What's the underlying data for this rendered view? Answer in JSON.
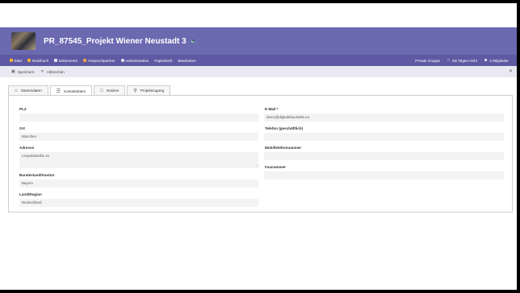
{
  "site": {
    "title": "PR_87545_Projekt Wiener Neustadt 3",
    "speaker_icon": "speaker-icon"
  },
  "nav": {
    "items": [
      {
        "label": "Start",
        "icon": "home-icon",
        "color": "#f0b429"
      },
      {
        "label": "Notizbuch",
        "icon": "notebook-icon",
        "color": "#f0b429"
      },
      {
        "label": "Dokumente",
        "icon": "documents-icon",
        "color": "#e6e6f0"
      },
      {
        "label": "Ansprechpartner",
        "icon": "contacts-icon",
        "color": "#f0a040"
      },
      {
        "label": "Administration",
        "icon": "gear-icon",
        "color": "#e6e6f0"
      },
      {
        "label": "Papierkorb",
        "icon": "",
        "color": ""
      },
      {
        "label": "Bearbeiten",
        "icon": "",
        "color": ""
      }
    ],
    "right": {
      "private_group": "Private Gruppe",
      "follow": "Sie folgen nicht",
      "members": "4 Mitglieder"
    }
  },
  "cmdbar": {
    "save": "Speichern",
    "cancel": "Abbrechen"
  },
  "tabs": [
    {
      "label": "Stammdaten",
      "icon": "home-icon"
    },
    {
      "label": "Kontaktdaten",
      "icon": "list-icon"
    },
    {
      "label": "Notizen",
      "icon": "note-icon"
    },
    {
      "label": "Projektzugang",
      "icon": "key-icon"
    }
  ],
  "form": {
    "plz": {
      "label": "PLZ",
      "value": ""
    },
    "ort": {
      "label": "Ort",
      "value": "München"
    },
    "adresse": {
      "label": "Adresse",
      "value": "Leopoldstraße 31"
    },
    "bundesland": {
      "label": "Bundesland/Kanton",
      "value": "Bayern"
    },
    "land": {
      "label": "Land/Region",
      "value": "Deutschland"
    },
    "email": {
      "label": "E-Mail *",
      "value": "demo@digitalebaustelle.eu"
    },
    "telefon": {
      "label": "Telefon (geschäftlich)",
      "value": ""
    },
    "mobil": {
      "label": "Mobiltelefonnummer",
      "value": ""
    },
    "fax": {
      "label": "Faxnummer",
      "value": ""
    }
  }
}
